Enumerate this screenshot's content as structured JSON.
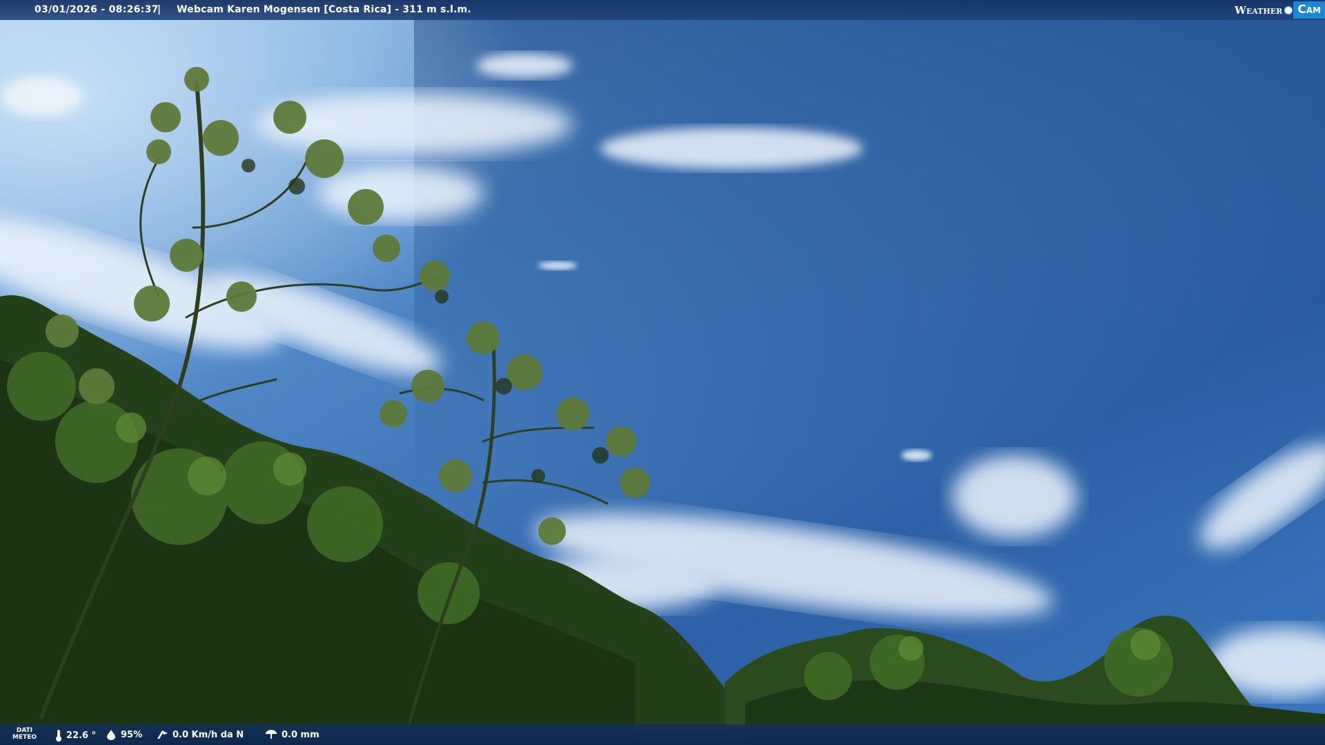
{
  "header": {
    "datetime": "03/01/2026 - 08:26:37",
    "separator": "|",
    "title": "Webcam Karen Mogensen [Costa Rica]  - 311 m s.l.m.",
    "logo_weather": "Weather",
    "logo_cam": "Cam"
  },
  "footer": {
    "dati_line1": "DATI",
    "dati_line2": "METEO",
    "temperature": "22.6 °",
    "humidity": "95%",
    "wind": "0.0 Km/h da N",
    "rain": "0.0 mm",
    "icons": [
      "thermometer-icon",
      "humidity-drop-icon",
      "wind-icon",
      "rain-gauge-icon"
    ]
  },
  "colors": {
    "sky_deep": "#1f4d8c",
    "sky_light": "#7fb0e0",
    "foliage": "#2f4a1e",
    "bar": "#163464",
    "logo_accent": "#1e86d8"
  }
}
